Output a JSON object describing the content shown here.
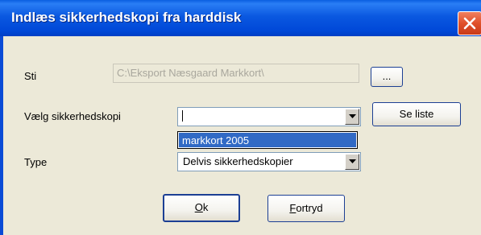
{
  "dialog": {
    "title": "Indlæs sikkerhedskopi fra harddisk"
  },
  "path_row": {
    "label": "Sti",
    "value": "C:\\Eksport Næsgaard Markkort\\",
    "browse_label": "..."
  },
  "backup_row": {
    "label": "Vælg sikkerhedskopi",
    "value": "",
    "list_button_label": "Se liste",
    "dropdown_options": [
      "markkort 2005"
    ]
  },
  "type_row": {
    "label": "Type",
    "value": "Delvis sikkerhedskopier"
  },
  "footer": {
    "ok_mnemonic": "O",
    "ok_rest": "k",
    "cancel_mnemonic": "F",
    "cancel_rest": "ortryd"
  },
  "colors": {
    "title_bar": "#0a58e0",
    "close_button": "#e0502a",
    "selection": "#316ac5",
    "dialog_bg": "#ece9d8"
  },
  "icons": {
    "close": "close-icon",
    "dropdown": "chevron-down-icon"
  }
}
